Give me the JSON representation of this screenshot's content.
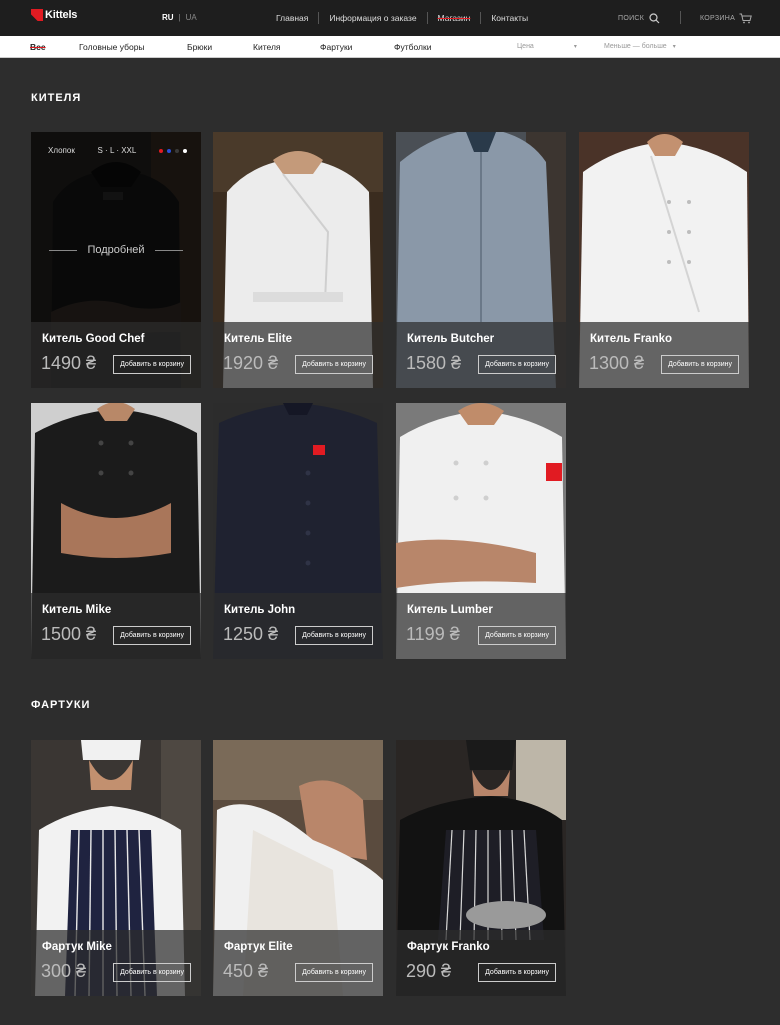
{
  "header": {
    "logo_text": "Kittels",
    "lang_ru": "RU",
    "lang_ua": "UA",
    "nav": [
      "Главная",
      "Информация о заказе",
      "Магазин",
      "Контакты"
    ],
    "search_label": "ПОИСК",
    "cart_label": "КОРЗИНА"
  },
  "filters": {
    "categories": [
      "Все",
      "Головные уборы",
      "Брюки",
      "Кителя",
      "Фартуки",
      "Футболки"
    ],
    "price_label": "Цена",
    "sort_label": "Меньше — больше"
  },
  "sections": [
    {
      "title": "КИТЕЛЯ",
      "products": [
        {
          "name": "Китель Good Chef",
          "price": "1490 ₴",
          "button": "Добавить в корзину"
        },
        {
          "name": "Китель Elite",
          "price": "1920 ₴",
          "button": "Добавить в корзину"
        },
        {
          "name": "Китель Butcher",
          "price": "1580 ₴",
          "button": "Добавить в корзину"
        },
        {
          "name": "Китель Franko",
          "price": "1300 ₴",
          "button": "Добавить в корзину"
        },
        {
          "name": "Китель Mike",
          "price": "1500 ₴",
          "button": "Добавить в корзину"
        },
        {
          "name": "Китель John",
          "price": "1250 ₴",
          "button": "Добавить в корзину"
        },
        {
          "name": "Китель Lumber",
          "price": "1199 ₴",
          "button": "Добавить в корзину"
        }
      ]
    },
    {
      "title": "ФАРТУКИ",
      "products": [
        {
          "name": "Фартук Mike",
          "price": "300 ₴",
          "button": "Добавить в корзину"
        },
        {
          "name": "Фартук Elite",
          "price": "450 ₴",
          "button": "Добавить в корзину"
        },
        {
          "name": "Фартук Franko",
          "price": "290 ₴",
          "button": "Добавить в корзину"
        }
      ]
    }
  ],
  "hover": {
    "material": "Хлопок",
    "sizes": "S · L · XXL",
    "more": "Подробней",
    "dot_colors": [
      "#e11b22",
      "#2b4fd8",
      "#3a3a3a",
      "#ffffff"
    ]
  },
  "colors": {
    "accent": "#e11b22",
    "background": "#2d2d2d",
    "topbar": "#1e1e1e"
  }
}
